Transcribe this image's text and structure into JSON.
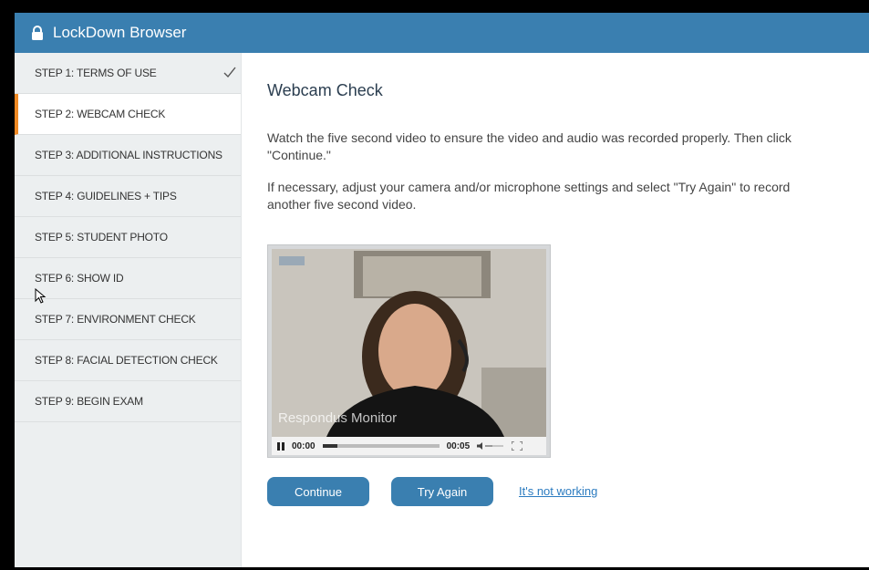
{
  "window": {
    "title": "LockDown Browser"
  },
  "sidebar": {
    "steps": [
      {
        "label": "STEP 1: TERMS OF USE",
        "completed": true
      },
      {
        "label": "STEP 2: WEBCAM CHECK",
        "active": true
      },
      {
        "label": "STEP 3: ADDITIONAL INSTRUCTIONS"
      },
      {
        "label": "STEP 4: GUIDELINES + TIPS"
      },
      {
        "label": "STEP 5: STUDENT PHOTO"
      },
      {
        "label": "STEP 6: SHOW ID"
      },
      {
        "label": "STEP 7: ENVIRONMENT CHECK"
      },
      {
        "label": "STEP 8: FACIAL DETECTION CHECK"
      },
      {
        "label": "STEP 9: BEGIN EXAM"
      }
    ]
  },
  "main": {
    "heading": "Webcam Check",
    "paragraph1": "Watch the five second video to ensure the video and audio was recorded properly. Then click \"Continue.\"",
    "paragraph2": "If necessary, adjust your camera and/or microphone settings and select \"Try Again\" to record another five second video."
  },
  "video": {
    "watermark": "Respondus Monitor",
    "current_time": "00:00",
    "duration": "00:05",
    "progress": 0.13
  },
  "actions": {
    "continue_label": "Continue",
    "try_again_label": "Try Again",
    "not_working_label": "It's not working"
  },
  "colors": {
    "header": "#3a7fb0",
    "active_accent": "#f08a24",
    "button": "#3a7fb0",
    "link": "#2b7bc0"
  },
  "icons": [
    "lock-icon",
    "check-icon",
    "pause-icon",
    "volume-icon",
    "fullscreen-icon",
    "mouse-cursor"
  ]
}
